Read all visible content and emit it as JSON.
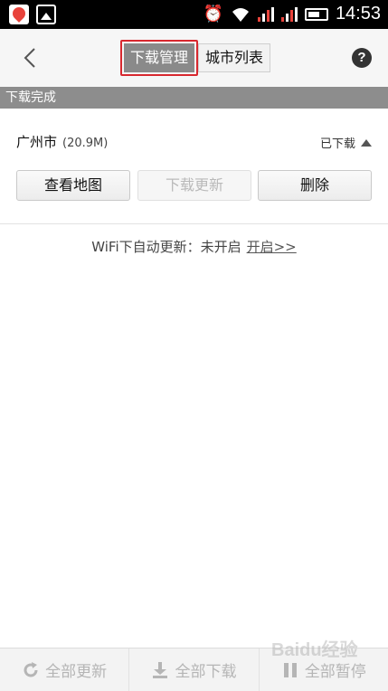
{
  "statusbar": {
    "time": "14:53"
  },
  "header": {
    "tabs": [
      {
        "label": "下载管理",
        "active": true
      },
      {
        "label": "城市列表",
        "active": false
      }
    ]
  },
  "section": {
    "title": "下载完成"
  },
  "city": {
    "name": "广州市",
    "size": "(20.9M)",
    "status": "已下载",
    "buttons": {
      "view_map": "查看地图",
      "update": "下载更新",
      "delete": "删除"
    }
  },
  "wifi": {
    "text": "WiFi下自动更新：未开启",
    "link": "开启>>"
  },
  "bottombar": {
    "update_all": "全部更新",
    "download_all": "全部下载",
    "pause_all": "全部暂停"
  },
  "watermark": {
    "text": "Baidu经验"
  },
  "colors": {
    "highlight_border": "#d8282f",
    "section_bar": "#8d8d8d",
    "active_tab": "#8a8a8a"
  }
}
